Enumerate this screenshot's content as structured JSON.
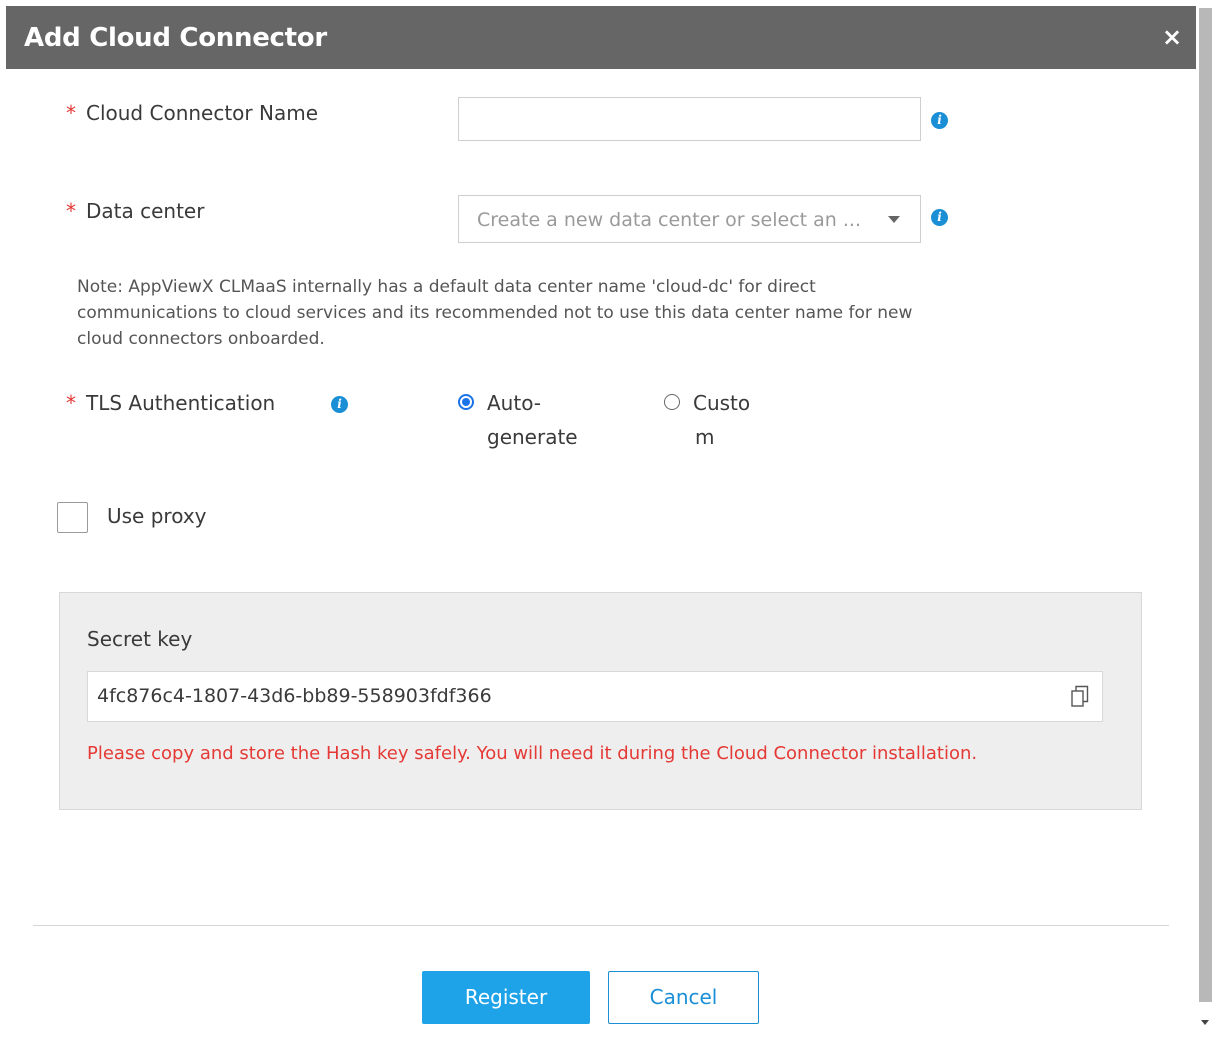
{
  "dialog": {
    "title": "Add Cloud Connector",
    "close_symbol": "×"
  },
  "form": {
    "name": {
      "label": "Cloud Connector Name",
      "required_mark": "*",
      "value": "",
      "info_icon": "info-icon"
    },
    "data_center": {
      "label": "Data center",
      "required_mark": "*",
      "placeholder": "Create a new data center or select an ...",
      "info_icon": "info-icon"
    },
    "note": "Note: AppViewX CLMaaS internally has a default data center name 'cloud-dc' for direct communications to cloud services and its recommended not to use this data center name for new cloud connectors onboarded.",
    "tls": {
      "label": "TLS Authentication",
      "required_mark": "*",
      "options": [
        {
          "label_line1": "Auto-",
          "label_line2": "generate",
          "selected": true
        },
        {
          "label_line1": "Custo",
          "label_line2": "m",
          "selected": false
        }
      ]
    },
    "use_proxy": {
      "label": "Use proxy",
      "checked": false
    }
  },
  "secret": {
    "title": "Secret key",
    "value": "4fc876c4-1807-43d6-bb89-558903fdf366",
    "warning": "Please copy and store the Hash key safely. You will need it during the Cloud Connector installation.",
    "warning_color": "#e53935"
  },
  "actions": {
    "register_label": "Register",
    "cancel_label": "Cancel",
    "primary_color": "#1fa3e8"
  }
}
